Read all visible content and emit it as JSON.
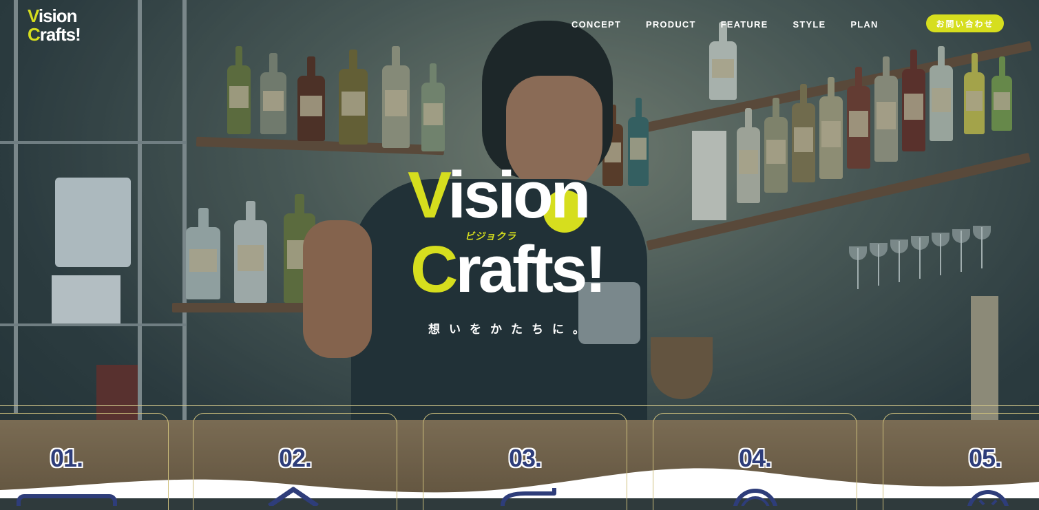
{
  "brand": {
    "logo_line1": "Vision",
    "logo_line2": "Crafts!",
    "accent_color": "#d6de1e",
    "navy_color": "#2e3d7a"
  },
  "nav": {
    "items": [
      "CONCEPT",
      "PRODUCT",
      "FEATURE",
      "STYLE",
      "PLAN"
    ],
    "contact_label": "お問い合わせ"
  },
  "hero": {
    "title_line1": "Vision",
    "ruby": "ビジョクラ",
    "title_line2": "Crafts!",
    "tagline": "想いをかたちに。"
  },
  "cards": [
    {
      "number": "01.",
      "icon": "card-icon"
    },
    {
      "number": "02.",
      "icon": "house-icon"
    },
    {
      "number": "03.",
      "icon": "speech-bubble-icon"
    },
    {
      "number": "04.",
      "icon": "circle-icon"
    },
    {
      "number": "05.",
      "icon": "smiley-icon"
    }
  ]
}
